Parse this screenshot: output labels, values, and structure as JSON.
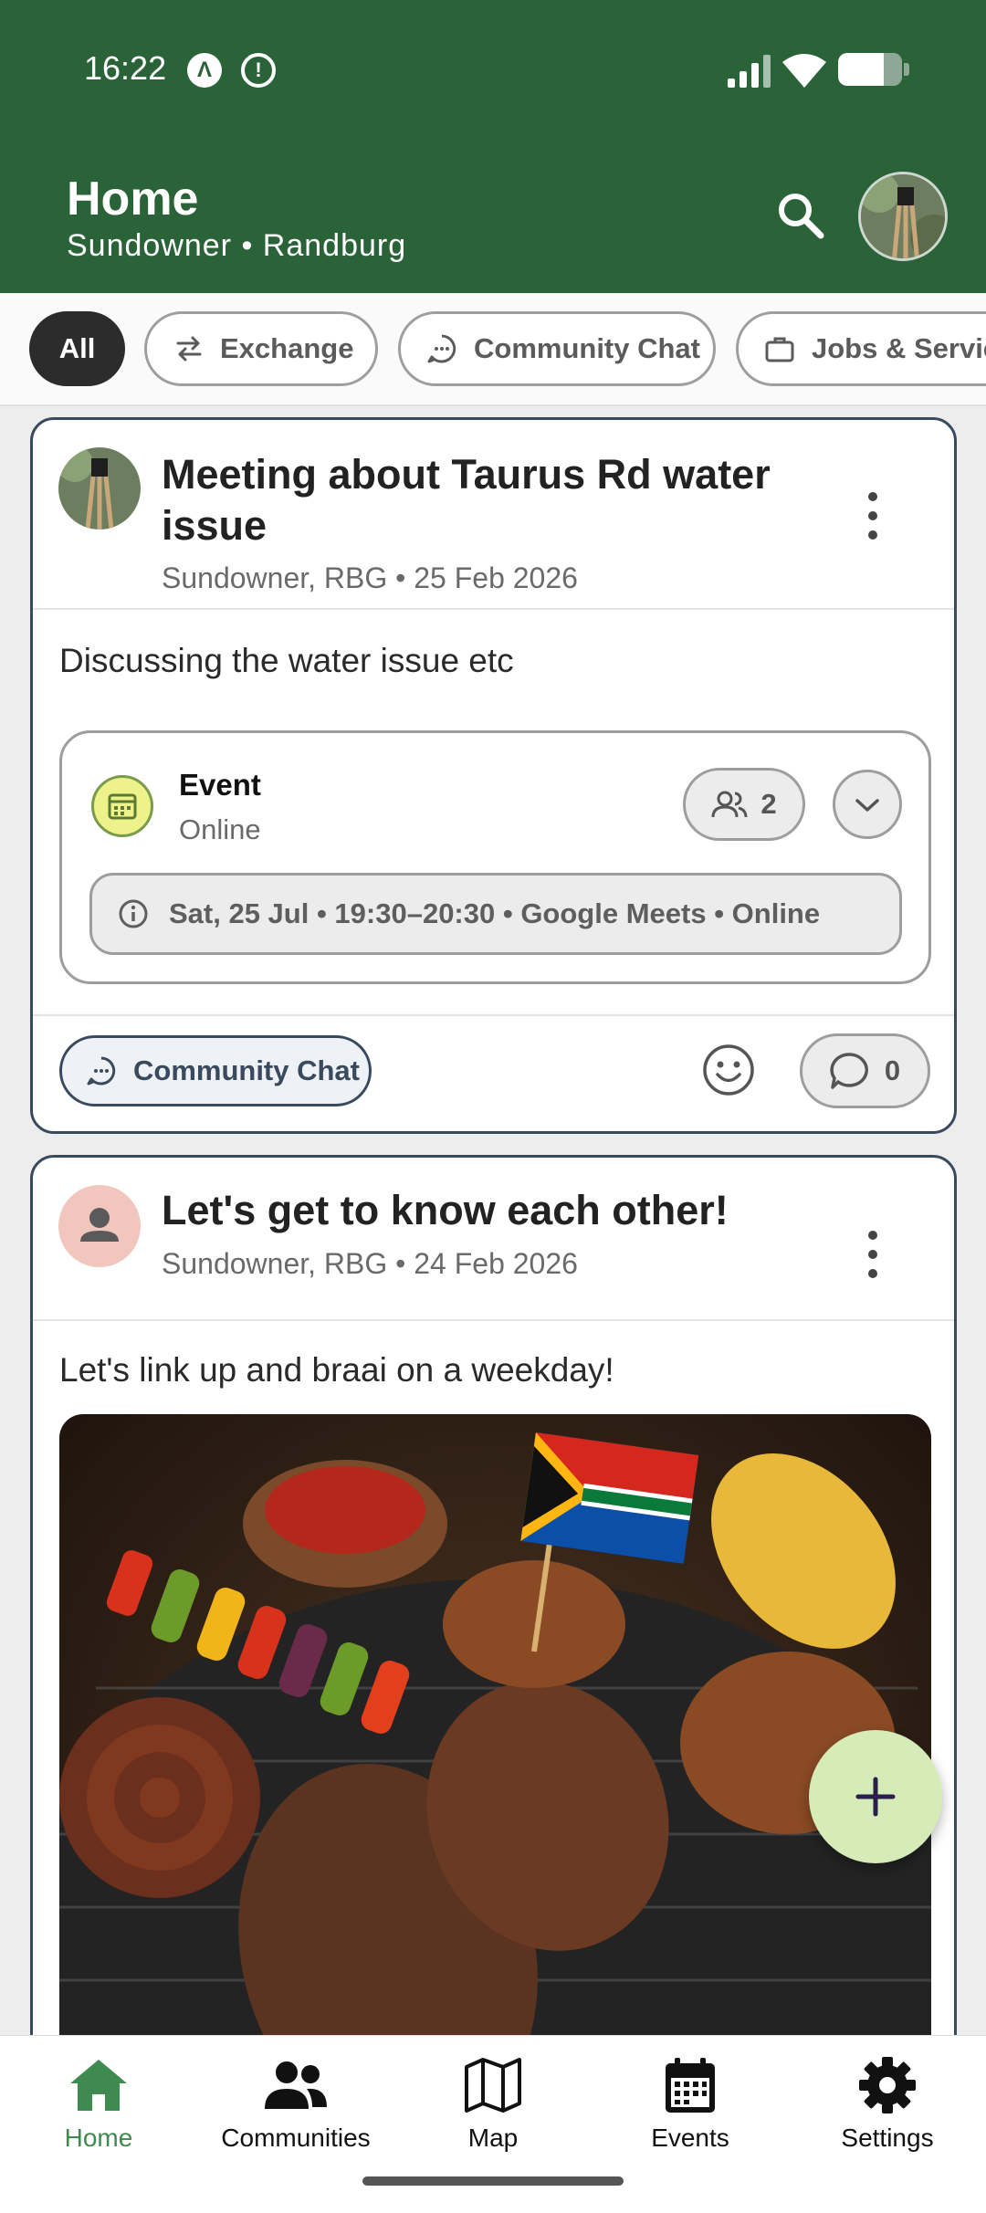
{
  "status_bar": {
    "time": "16:22",
    "icon_a": "Λ",
    "icon_b": "!"
  },
  "header": {
    "title": "Home",
    "subtitle": "Sundowner • Randburg"
  },
  "filters": [
    {
      "label": "All",
      "selected": true
    },
    {
      "label": "Exchange",
      "icon": "swap-icon"
    },
    {
      "label": "Community Chat",
      "icon": "chat-icon"
    },
    {
      "label": "Jobs & Servic",
      "icon": "briefcase-icon"
    }
  ],
  "posts": [
    {
      "title": "Meeting about Taurus Rd water issue",
      "meta": "Sundowner, RBG • 25 Feb 2026",
      "body": "Discussing the water issue etc",
      "event": {
        "label": "Event",
        "location": "Online",
        "attendees": "2",
        "details": "Sat, 25 Jul • 19:30–20:30 • Google Meets • Online"
      },
      "tag": "Community Chat",
      "comments": "0"
    },
    {
      "title": "Let's get to know each other!",
      "meta": "Sundowner, RBG • 24 Feb 2026",
      "body": "Let's link up and braai on a weekday!"
    }
  ],
  "nav": [
    {
      "label": "Home",
      "icon": "home-icon",
      "active": true
    },
    {
      "label": "Communities",
      "icon": "people-icon"
    },
    {
      "label": "Map",
      "icon": "map-icon"
    },
    {
      "label": "Events",
      "icon": "calendar-icon"
    },
    {
      "label": "Settings",
      "icon": "gear-icon"
    }
  ],
  "colors": {
    "brand": "#2b6339",
    "accent": "#3e8a4f",
    "fab": "#d6ecb8"
  }
}
